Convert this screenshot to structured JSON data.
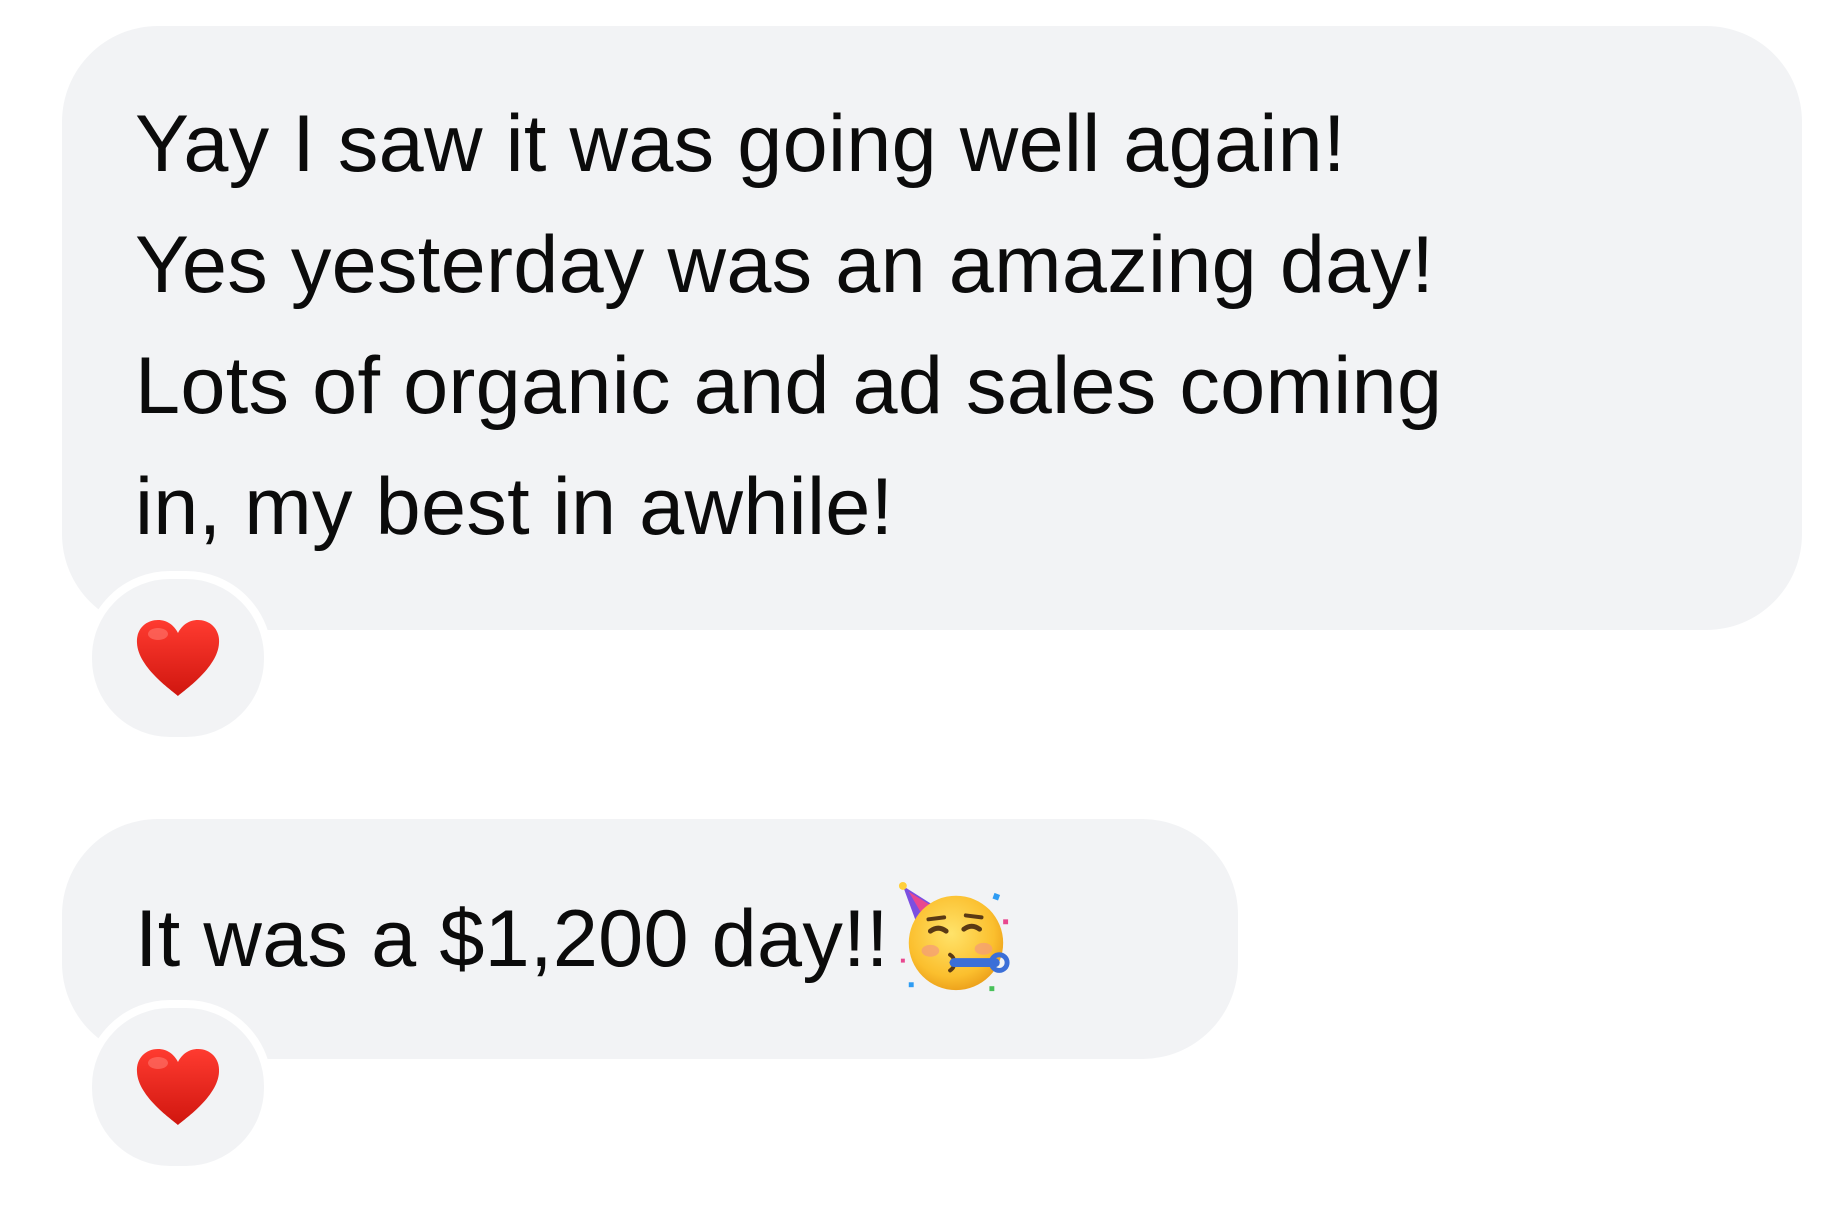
{
  "messages": [
    {
      "text": "Yay I saw it was going well again!\nYes yesterday was an amazing day!\nLots of organic and ad sales coming\nin, my best in awhile!",
      "reaction": {
        "icon": "red-heart-icon",
        "color": "#e0231d"
      }
    },
    {
      "text": "It was a $1,200 day!!",
      "trailing_emoji": "partying-face-icon",
      "reaction": {
        "icon": "red-heart-icon",
        "color": "#e0231d"
      }
    }
  ],
  "colors": {
    "bubble_background": "#f2f3f5",
    "page_background": "#ffffff",
    "text": "#0b0b0b"
  }
}
